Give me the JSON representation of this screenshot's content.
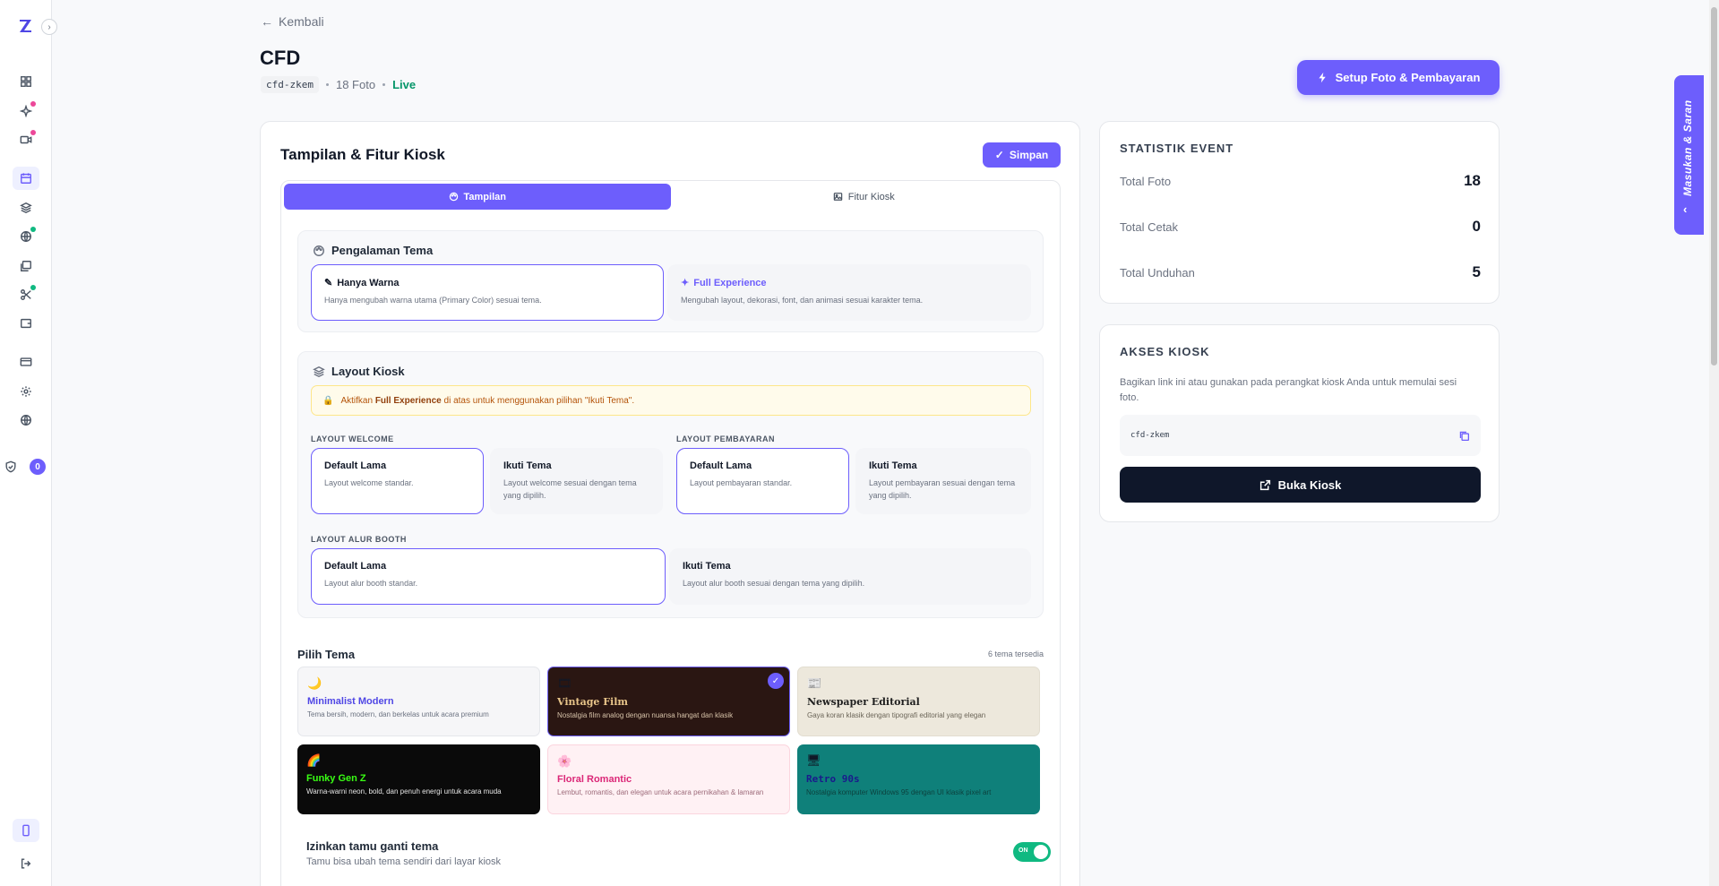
{
  "sidebar": {
    "badge_count": "0",
    "collapse_glyph": "›"
  },
  "header": {
    "back_label": "Kembali",
    "title": "CFD",
    "code": "cfd-zkem",
    "photo_count": "18 Foto",
    "status": "Live",
    "setup_button": "Setup Foto & Pembayaran"
  },
  "main": {
    "title": "Tampilan & Fitur Kiosk",
    "save_button": "Simpan",
    "tabs": [
      {
        "label": "Tampilan",
        "icon": "palette-icon"
      },
      {
        "label": "Fitur Kiosk",
        "icon": "image-icon"
      }
    ],
    "theme_experience": {
      "heading": "Pengalaman Tema",
      "options": [
        {
          "title": "Hanya Warna",
          "desc": "Hanya mengubah warna utama (Primary Color) sesuai tema."
        },
        {
          "title": "Full Experience",
          "desc": "Mengubah layout, dekorasi, font, dan animasi sesuai karakter tema."
        }
      ]
    },
    "layout": {
      "heading": "Layout Kiosk",
      "warning_prefix": "Aktifkan",
      "warning_bold": "Full Experience",
      "warning_suffix": "di atas untuk menggunakan pilihan \"Ikuti Tema\".",
      "welcome": {
        "label": "LAYOUT WELCOME",
        "default_title": "Default Lama",
        "default_desc": "Layout welcome standar.",
        "follow_title": "Ikuti Tema",
        "follow_desc": "Layout welcome sesuai dengan tema yang dipilih."
      },
      "payment": {
        "label": "LAYOUT PEMBAYARAN",
        "default_title": "Default Lama",
        "default_desc": "Layout pembayaran standar.",
        "follow_title": "Ikuti Tema",
        "follow_desc": "Layout pembayaran sesuai dengan tema yang dipilih."
      },
      "booth": {
        "label": "LAYOUT ALUR BOOTH",
        "default_title": "Default Lama",
        "default_desc": "Layout alur booth standar.",
        "follow_title": "Ikuti Tema",
        "follow_desc": "Layout alur booth sesuai dengan tema yang dipilih."
      }
    },
    "themes": {
      "heading": "Pilih Tema",
      "count": "6 tema tersedia",
      "items": [
        {
          "icon": "🌙",
          "name": "Minimalist Modern",
          "desc": "Tema bersih, modern, dan berkelas untuk acara premium"
        },
        {
          "icon": "🎞",
          "name": "Vintage Film",
          "desc": "Nostalgia film analog dengan nuansa hangat dan klasik"
        },
        {
          "icon": "📰",
          "name": "Newspaper Editorial",
          "desc": "Gaya koran klasik dengan tipografi editorial yang elegan"
        },
        {
          "icon": "🌈",
          "name": "Funky Gen Z",
          "desc": "Warna-warni neon, bold, dan penuh energi untuk acara muda"
        },
        {
          "icon": "🌸",
          "name": "Floral Romantic",
          "desc": "Lembut, romantis, dan elegan untuk acara pernikahan & lamaran"
        },
        {
          "icon": "🖥",
          "name": "Retro 90s",
          "desc": "Nostalgia komputer Windows 95 dengan UI klasik pixel art"
        }
      ]
    },
    "guest_theme": {
      "title": "Izinkan tamu ganti tema",
      "desc": "Tamu bisa ubah tema sendiri dari layar kiosk",
      "toggle": "ON"
    }
  },
  "stats": {
    "heading": "STATISTIK EVENT",
    "rows": [
      {
        "label": "Total Foto",
        "value": "18"
      },
      {
        "label": "Total Cetak",
        "value": "0"
      },
      {
        "label": "Total Unduhan",
        "value": "5"
      }
    ]
  },
  "access": {
    "heading": "AKSES KIOSK",
    "desc": "Bagikan link ini atau gunakan pada perangkat kiosk Anda untuk memulai sesi foto.",
    "code": "cfd-zkem",
    "open_button": "Buka Kiosk"
  },
  "feedback": {
    "label": "Masukan & Saran"
  },
  "colors": {
    "accent": "#6d5efc",
    "live": "#059669",
    "toggle_on": "#10b981"
  }
}
